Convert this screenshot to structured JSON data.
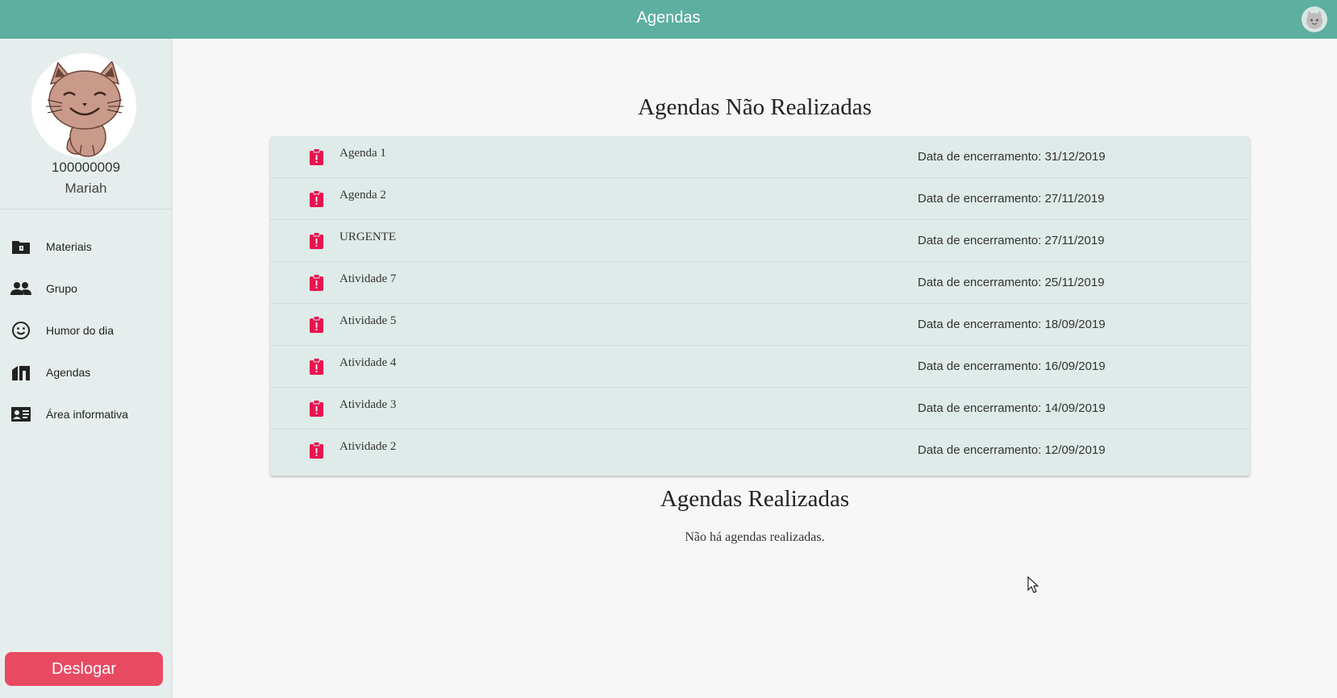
{
  "header": {
    "title": "Agendas",
    "avatar_icon": "cat-avatar-icon"
  },
  "profile": {
    "id": "100000009",
    "name": "Mariah"
  },
  "sidebar": {
    "items": [
      {
        "label": "Materiais",
        "icon": "folder-icon"
      },
      {
        "label": "Grupo",
        "icon": "group-icon"
      },
      {
        "label": "Humor do dia",
        "icon": "smiley-icon"
      },
      {
        "label": "Agendas",
        "icon": "agenda-icon"
      },
      {
        "label": "Área informativa",
        "icon": "contact-card-icon"
      }
    ],
    "logout_label": "Deslogar"
  },
  "pending": {
    "title": "Agendas Não Realizadas",
    "items": [
      {
        "name": "Agenda 1",
        "date": "Data de encerramento: 31/12/2019"
      },
      {
        "name": "Agenda 2",
        "date": "Data de encerramento: 27/11/2019"
      },
      {
        "name": "URGENTE",
        "date": "Data de encerramento: 27/11/2019"
      },
      {
        "name": "Atividade 7",
        "date": "Data de encerramento: 25/11/2019"
      },
      {
        "name": "Atividade 5",
        "date": "Data de encerramento: 18/09/2019"
      },
      {
        "name": "Atividade 4",
        "date": "Data de encerramento: 16/09/2019"
      },
      {
        "name": "Atividade 3",
        "date": "Data de encerramento: 14/09/2019"
      },
      {
        "name": "Atividade 2",
        "date": "Data de encerramento: 12/09/2019"
      }
    ]
  },
  "done": {
    "title": "Agendas Realizadas",
    "empty_message": "Não há agendas realizadas."
  },
  "colors": {
    "header": "#5daf9f",
    "sidebar": "#e6eeed",
    "list_bg": "#dfebe9",
    "accent_red": "#e8144f",
    "logout": "#e84a62"
  }
}
